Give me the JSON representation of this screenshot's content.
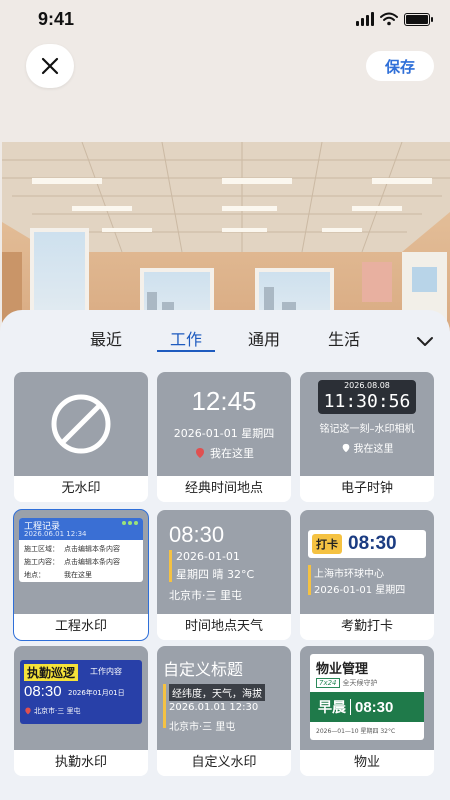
{
  "status": {
    "time": "9:41"
  },
  "header": {
    "save_label": "保存"
  },
  "tabs": [
    {
      "label": "最近",
      "active": false
    },
    {
      "label": "工作",
      "active": true
    },
    {
      "label": "通用",
      "active": false
    },
    {
      "label": "生活",
      "active": false
    }
  ],
  "cards": [
    {
      "label": "无水印"
    },
    {
      "label": "经典时间地点",
      "time": "12:45",
      "date": "2026-01-01 星期四",
      "location": "我在这里"
    },
    {
      "label": "电子时钟",
      "date": "2026.08.08",
      "time": "11:30:56",
      "slogan": "铭记这一刻–水印相机",
      "location": "我在这里"
    },
    {
      "label": "工程水印",
      "title": "工程记录",
      "datetime": "2026.06.01 12:34",
      "rows": [
        {
          "key": "施工区域：",
          "value": "点击编辑本条内容"
        },
        {
          "key": "施工内容：",
          "value": "点击编辑本条内容"
        },
        {
          "key": "地点：",
          "value": "我在这里"
        }
      ]
    },
    {
      "label": "时间地点天气",
      "time": "08:30",
      "date": "2026-01-01",
      "weather": "星期四 晴 32°C",
      "location": "北京市·三 里屯"
    },
    {
      "label": "考勤打卡",
      "badge": "打卡",
      "time": "08:30",
      "location": "上海市环球中心",
      "date": "2026-01-01 星期四"
    },
    {
      "label": "执勤水印",
      "title": "执勤巡逻",
      "content": "工作内容",
      "time": "08:30",
      "date": "2026年01月01日",
      "location": "北京市·三 里屯"
    },
    {
      "label": "自定义水印",
      "title": "自定义标题",
      "coords": "经纬度，天气，海拔",
      "datetime": "2026.01.01 12:30",
      "location": "北京市·三 里屯"
    },
    {
      "label": "物业",
      "title": "物业管理",
      "tag": "7x24",
      "tag_text": "全天候守护",
      "shift": "早晨",
      "time": "08:30",
      "footer": "2026—01—10 星期四 32°C"
    }
  ],
  "colors": {
    "accent": "#2f6fd8",
    "card_preview": "#9ba1aa"
  }
}
